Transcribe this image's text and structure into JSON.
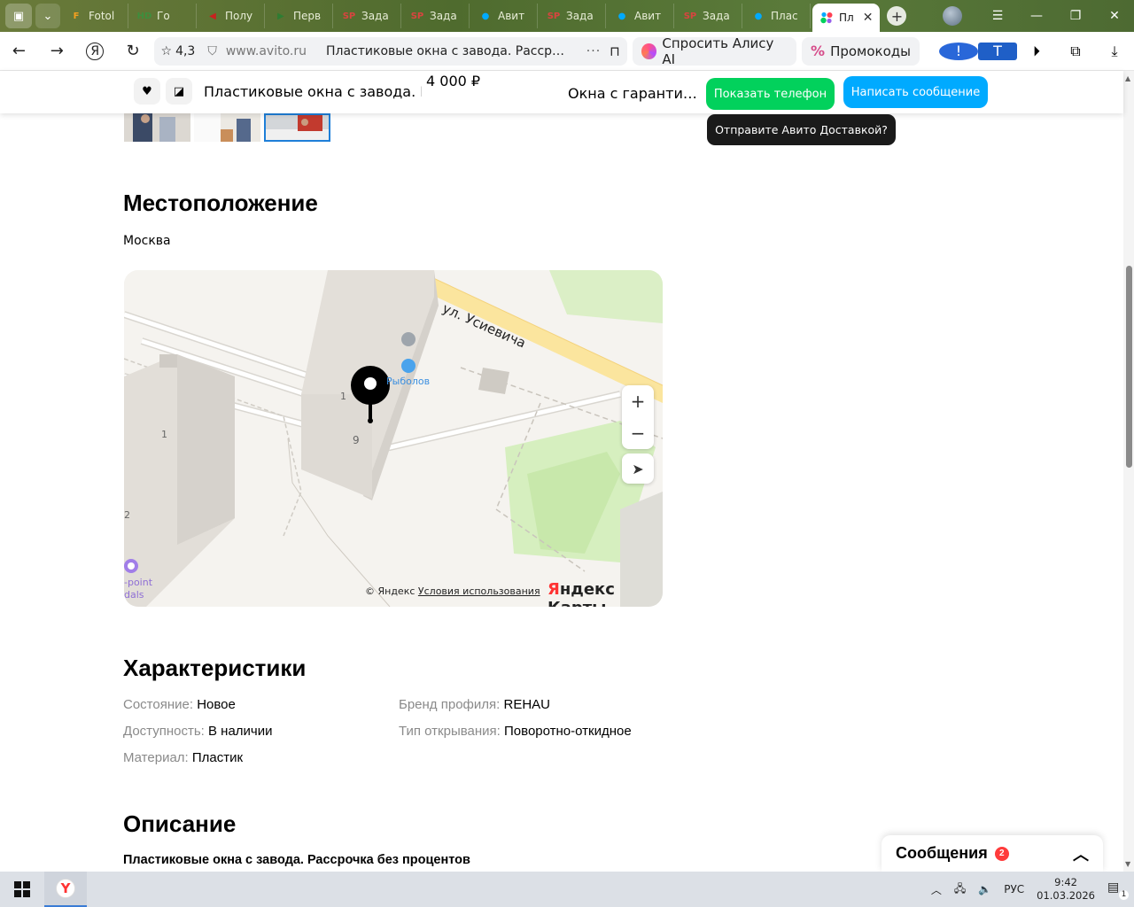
{
  "browser": {
    "tabs": [
      {
        "label": "Fotol",
        "fav": "F",
        "favColor": "#f4a020"
      },
      {
        "label": "Го",
        "fav": "HD",
        "favColor": "#3d8f3d"
      },
      {
        "label": "Полу",
        "fav": "◀",
        "favColor": "#c8201e"
      },
      {
        "label": "Перв",
        "fav": "▶",
        "favColor": "#2e7d32"
      },
      {
        "label": "Зада",
        "fav": "SP",
        "favColor": "#d9443f"
      },
      {
        "label": "Зада",
        "fav": "SP",
        "favColor": "#d9443f"
      },
      {
        "label": "Авит",
        "fav": "●",
        "favColor": "#00aaff"
      },
      {
        "label": "Зада",
        "fav": "SP",
        "favColor": "#d9443f"
      },
      {
        "label": "Авит",
        "fav": "●",
        "favColor": "#00aaff"
      },
      {
        "label": "Зада",
        "fav": "SP",
        "favColor": "#d9443f"
      },
      {
        "label": "Плас",
        "fav": "●",
        "favColor": "#00aaff"
      }
    ],
    "active_tab": {
      "label": "Пл"
    },
    "rating": "4,3",
    "domain": "www.avito.ru",
    "page_title": "Пластиковые окна с завода. Расср…",
    "alice_label": "Спросить Алису AI",
    "promo_label": "Промокоды"
  },
  "sticky": {
    "title": "Пластиковые окна с завода. Р…",
    "price": "4 000 ₽",
    "subtitle": "Окна с гаранти…",
    "phone_btn": "Показать телефон",
    "message_btn": "Написать сообщение",
    "tooltip": "Отправите Авито Доставкой?"
  },
  "location": {
    "heading": "Местоположение",
    "city": "Москва",
    "map": {
      "street": "ул. Усиевича",
      "poi": "Рыболов",
      "house": "9",
      "entrance1": "1",
      "entrance2": "1",
      "label2": "2",
      "poi2a": "-point",
      "poi2b": "dals",
      "zoom_in": "+",
      "zoom_out": "−",
      "copyright": "© Яндекс",
      "terms": "Условия использования",
      "brand_a": "Я",
      "brand_b": "ндекс Карты"
    }
  },
  "characteristics": {
    "heading": "Характеристики",
    "left": [
      {
        "k": "Состояние:",
        "v": "Новое"
      },
      {
        "k": "Доступность:",
        "v": "В наличии"
      },
      {
        "k": "Материал:",
        "v": "Пластик"
      }
    ],
    "right": [
      {
        "k": "Бренд профиля:",
        "v": "REHAU"
      },
      {
        "k": "Тип открывания:",
        "v": "Поворотно-откидное"
      }
    ]
  },
  "description": {
    "heading": "Описание",
    "first_line": "Пластиковые окна с завода. Рассрочка без процентов"
  },
  "messages": {
    "label": "Сообщения",
    "count": "2"
  },
  "taskbar": {
    "lang": "РУС",
    "time": "9:42",
    "date": "01.03.2026",
    "notif_count": "1"
  }
}
